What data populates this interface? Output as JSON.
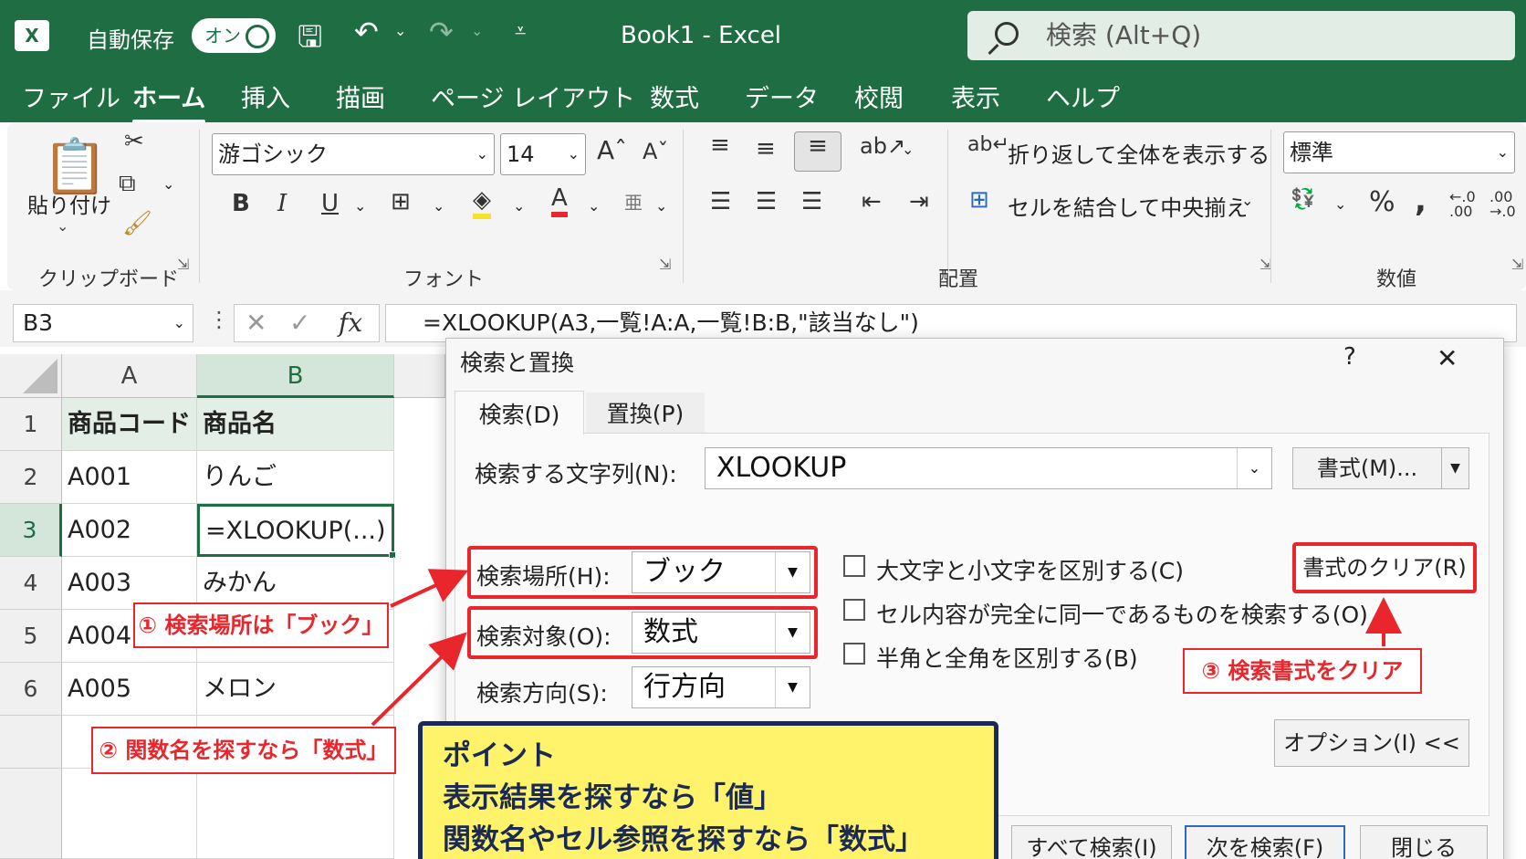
{
  "app": {
    "logo_letter": "X",
    "autosave_label": "自動保存",
    "autosave_state": "オン",
    "doc_title": "Book1  -  Excel",
    "search_placeholder": "検索 (Alt+Q)"
  },
  "menu": [
    "ファイル",
    "ホーム",
    "挿入",
    "描画",
    "ページ レイアウト",
    "数式",
    "データ",
    "校閲",
    "表示",
    "ヘルプ"
  ],
  "ribbon": {
    "paste_label": "貼り付け",
    "clipboard_label": "クリップボード",
    "font_name": "游ゴシック",
    "font_size": "14",
    "font_label": "フォント",
    "wrap_text": "折り返して全体を表示する",
    "merge_center": "セルを結合して中央揃え",
    "alignment_label": "配置",
    "number_format": "標準",
    "number_label": "数値"
  },
  "formula_bar": {
    "name_box": "B3",
    "formula": "=XLOOKUP(A3,一覧!A:A,一覧!B:B,\"該当なし\")"
  },
  "sheet": {
    "columns": [
      "A",
      "B"
    ],
    "rows": [
      {
        "num": "1",
        "a": "商品コード",
        "b": "商品名"
      },
      {
        "num": "2",
        "a": "A001",
        "b": "りんご"
      },
      {
        "num": "3",
        "a": "A002",
        "b": "=XLOOKUP(...)"
      },
      {
        "num": "4",
        "a": "A003",
        "b": "みかん"
      },
      {
        "num": "5",
        "a": "A004",
        "b": ""
      },
      {
        "num": "6",
        "a": "A005",
        "b": "メロン"
      }
    ]
  },
  "dialog": {
    "title": "検索と置換",
    "help": "?",
    "close": "X",
    "tab_find": "検索(D)",
    "tab_replace": "置換(P)",
    "find_what_label": "検索する文字列(N):",
    "find_what_value": "XLOOKUP",
    "format_button": "書式(M)...",
    "within_label": "検索場所(H):",
    "within_value": "ブック",
    "look_in_label": "検索対象(O):",
    "look_in_value": "数式",
    "search_dir_label": "検索方向(S):",
    "search_dir_value": "行方向",
    "opt_case": "大文字と小文字を区別する(C)",
    "opt_entire": "セル内容が完全に同一であるものを検索する(O)",
    "opt_width": "半角と全角を区別する(B)",
    "clear_format": "書式のクリア(R)",
    "options_button": "オプション(I) <<",
    "find_all": "すべて検索(I)",
    "find_next": "次を検索(F)",
    "close_button": "閉じる"
  },
  "annotations": {
    "note1": "① 検索場所は「ブック」",
    "note2": "② 関数名を探すなら「数式」",
    "note3": "③ 検索書式をクリア",
    "point_title": "ポイント",
    "point_line1": "表示結果を探すなら「値」",
    "point_line2": "関数名やセル参照を探すなら「数式」"
  },
  "colors": {
    "excel_green": "#1f6e43",
    "annotation_red": "#e8262c",
    "point_yellow": "#fef36a",
    "point_navy": "#1a2a55"
  }
}
